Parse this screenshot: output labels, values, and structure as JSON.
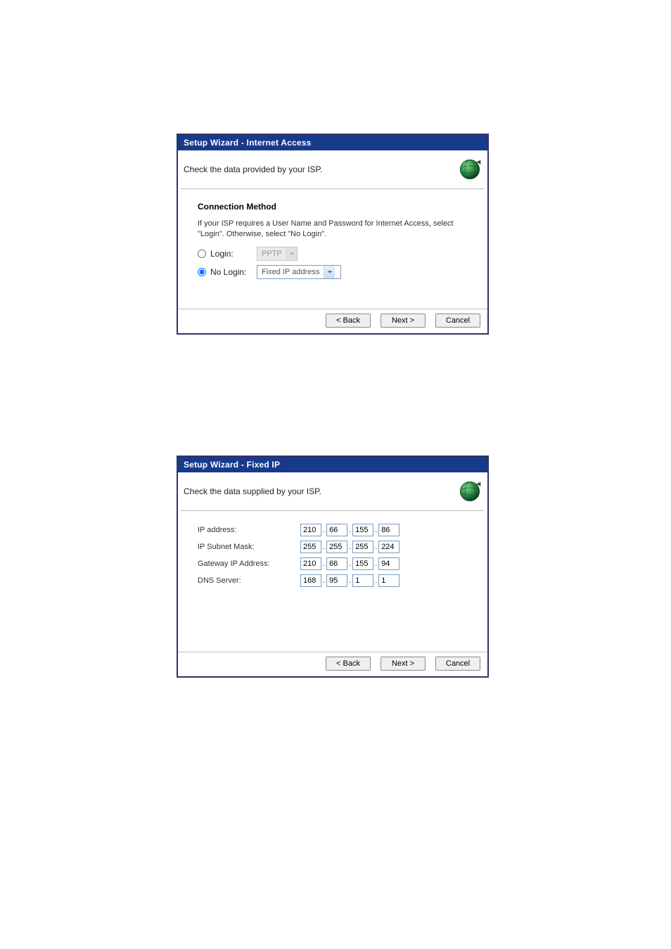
{
  "panel1": {
    "title": "Setup Wizard - Internet Access",
    "header": "Check the data provided by your ISP.",
    "section_heading": "Connection Method",
    "helper_text": "If your ISP requires a User Name and Password for Internet Access, select \"Login\". Otherwise, select \"No Login\".",
    "login_label": "Login:",
    "nologin_label": "No Login:",
    "login_select_value": "PPTP",
    "nologin_select_value": "Fixed IP address",
    "buttons": {
      "back": "< Back",
      "next": "Next >",
      "cancel": "Cancel"
    }
  },
  "panel2": {
    "title": "Setup Wizard - Fixed IP",
    "header": "Check the data supplied by your ISP.",
    "rows": {
      "ip_label": "IP address:",
      "subnet_label": "IP Subnet Mask:",
      "gateway_label": "Gateway IP Address:",
      "dns_label": "DNS Server:"
    },
    "ip": {
      "a": "210",
      "b": "66",
      "c": "155",
      "d": "86"
    },
    "subnet": {
      "a": "255",
      "b": "255",
      "c": "255",
      "d": "224"
    },
    "gateway": {
      "a": "210",
      "b": "66",
      "c": "155",
      "d": "94"
    },
    "dns": {
      "a": "168",
      "b": "95",
      "c": "1",
      "d": "1"
    },
    "buttons": {
      "back": "< Back",
      "next": "Next >",
      "cancel": "Cancel"
    }
  }
}
